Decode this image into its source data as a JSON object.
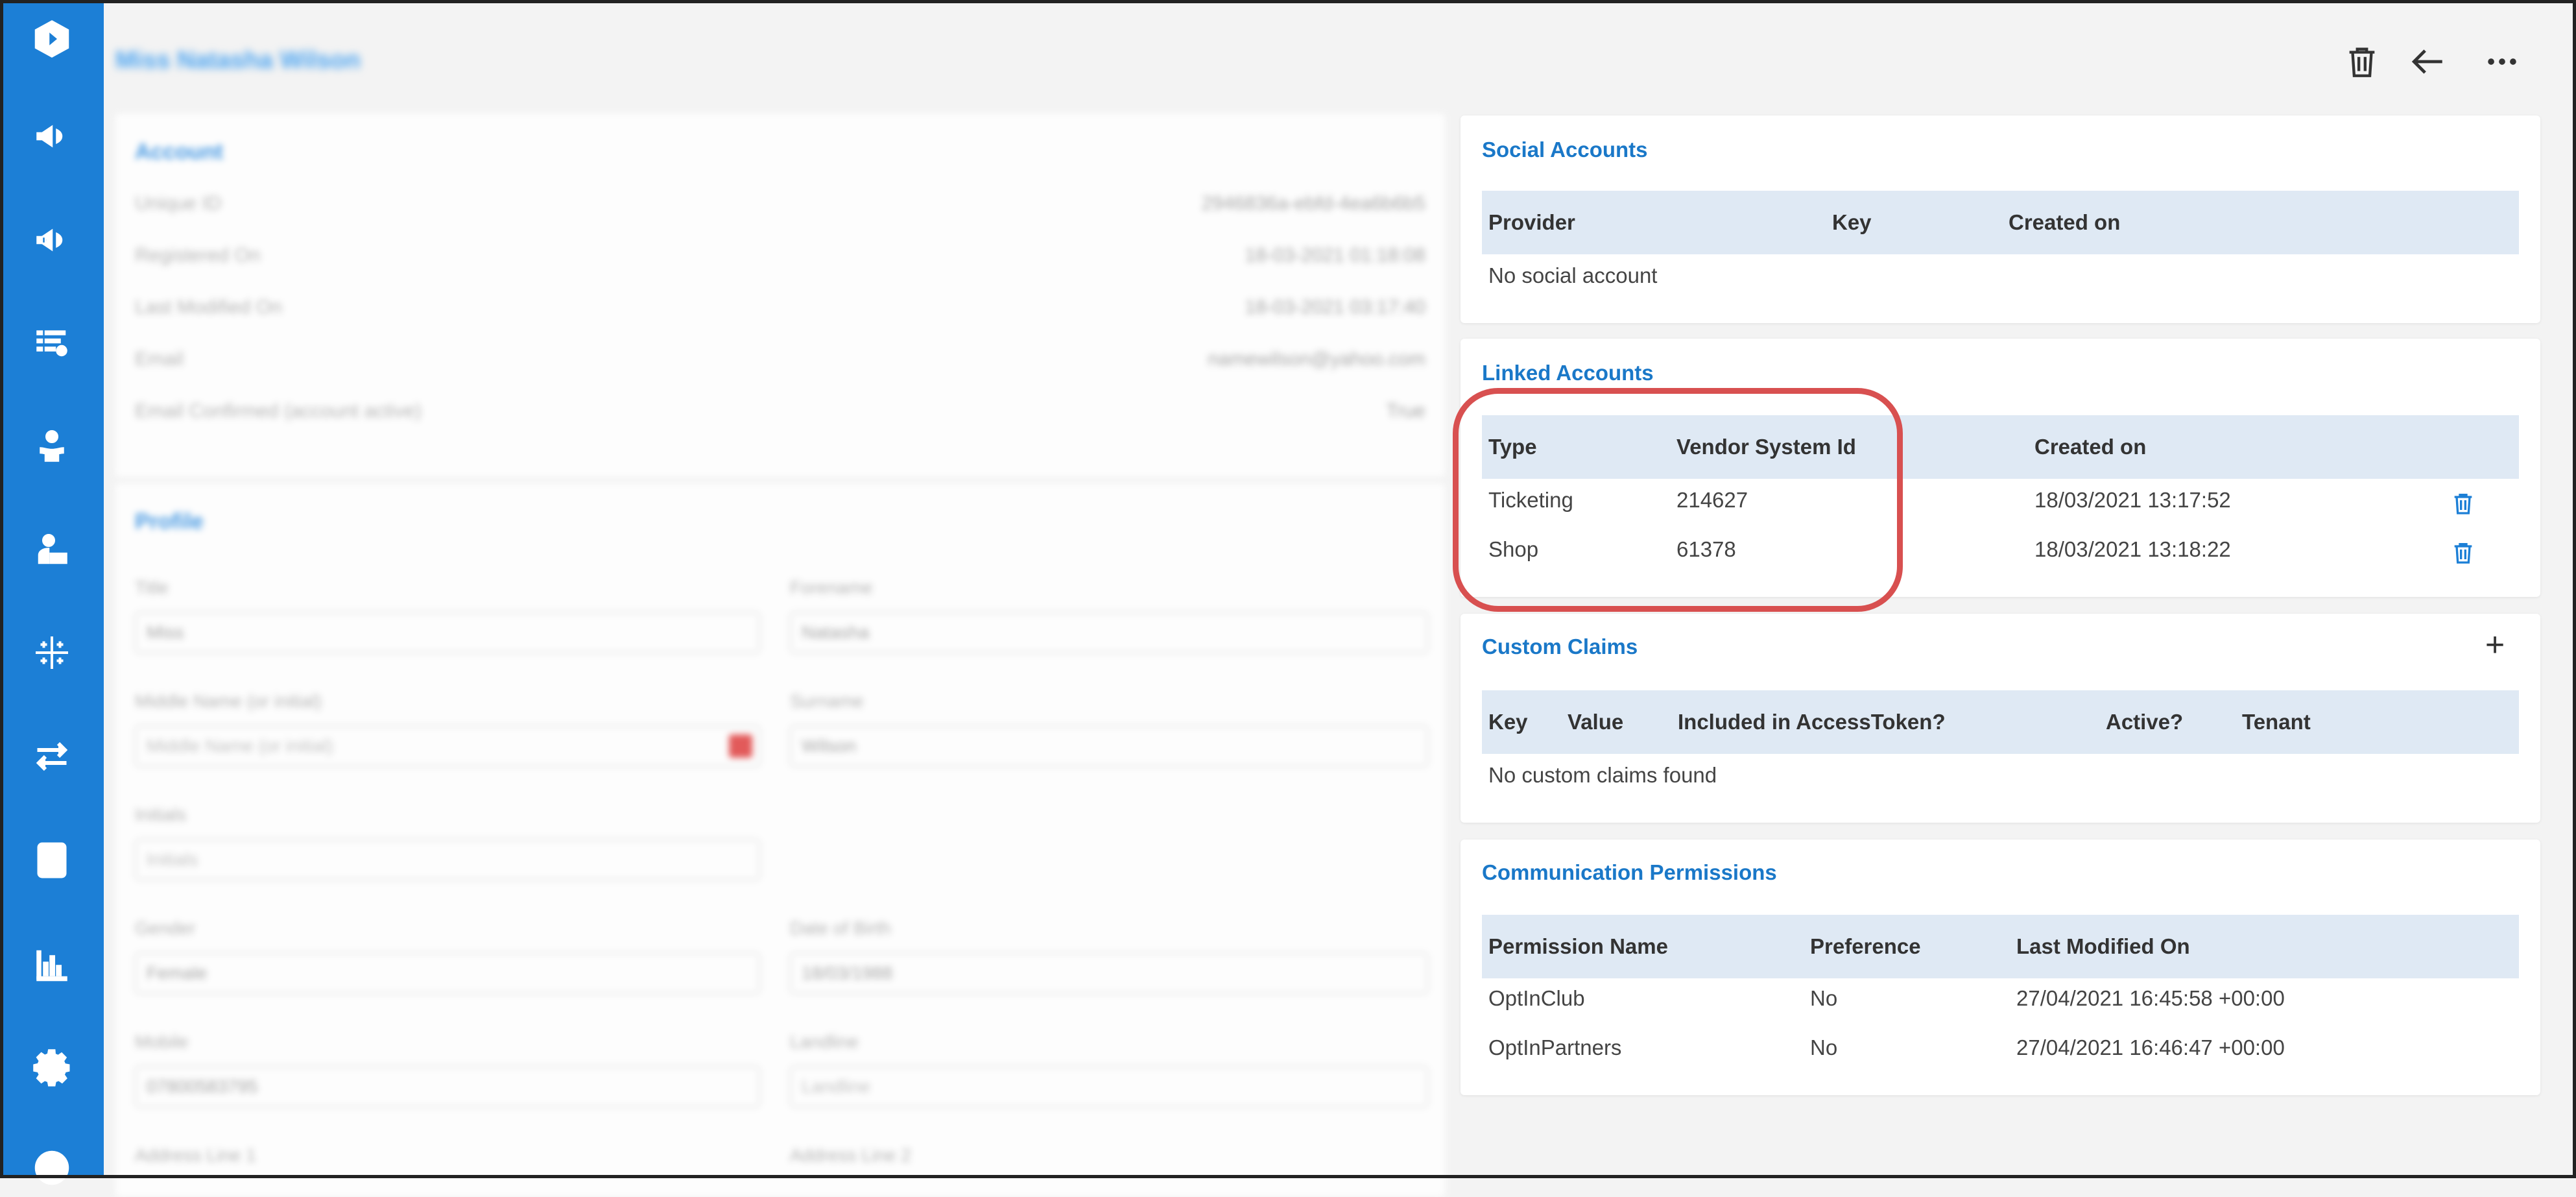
{
  "header": {
    "title": "Miss Natasha Wilson",
    "actions": [
      "trash-icon",
      "back-arrow-icon",
      "more-icon"
    ]
  },
  "sidebar": {
    "items": [
      "logo",
      "megaphone-icon",
      "megaphone-plus-icon",
      "list-settings-icon",
      "user-hand-icon",
      "user-desk-icon",
      "grid-icon",
      "transfer-icon",
      "contact-card-icon",
      "bar-chart-icon",
      "gear-icon",
      "help-icon"
    ]
  },
  "account": {
    "title": "Account",
    "rows": [
      {
        "label": "Unique ID",
        "value": "2946836a-ebfd-4ea6b6b5"
      },
      {
        "label": "Registered On",
        "value": "18-03-2021 01:18:08"
      },
      {
        "label": "Last Modified On",
        "value": "18-03-2021 03:17:40"
      },
      {
        "label": "Email",
        "value": "namewilson@yahoo.com"
      },
      {
        "label": "Email Confirmed (account active)",
        "value": "True"
      }
    ]
  },
  "profile": {
    "title": "Profile",
    "fields": [
      {
        "label": "Title",
        "value": "Miss"
      },
      {
        "label": "Forename",
        "value": "Natasha"
      },
      {
        "label": "Middle Name (or initial)",
        "value": "Middle Name (or initial)"
      },
      {
        "label": "Surname",
        "value": "Wilson"
      },
      {
        "label": "Initials",
        "value": "Initials"
      },
      {
        "label": "Gender",
        "value": "Female"
      },
      {
        "label": "Date of Birth",
        "value": "18/03/1988"
      },
      {
        "label": "Mobile",
        "value": "07800583795"
      },
      {
        "label": "Landline",
        "value": "Landline"
      },
      {
        "label": "Address Line 1",
        "value": ""
      },
      {
        "label": "Address Line 2",
        "value": ""
      }
    ]
  },
  "social_accounts": {
    "title": "Social Accounts",
    "columns": [
      "Provider",
      "Key",
      "Created on"
    ],
    "empty": "No social account"
  },
  "linked_accounts": {
    "title": "Linked Accounts",
    "columns": [
      "Type",
      "Vendor System Id",
      "Created on"
    ],
    "rows": [
      {
        "type": "Ticketing",
        "vendor_id": "214627",
        "created": "18/03/2021 13:17:52"
      },
      {
        "type": "Shop",
        "vendor_id": "61378",
        "created": "18/03/2021 13:18:22"
      }
    ]
  },
  "custom_claims": {
    "title": "Custom Claims",
    "add_label": "+",
    "columns": [
      "Key",
      "Value",
      "Included in AccessToken?",
      "Active?",
      "Tenant"
    ],
    "empty": "No custom claims found"
  },
  "communication_permissions": {
    "title": "Communication Permissions",
    "columns": [
      "Permission Name",
      "Preference",
      "Last Modified On"
    ],
    "rows": [
      {
        "name": "OptInClub",
        "preference": "No",
        "modified": "27/04/2021 16:45:58 +00:00"
      },
      {
        "name": "OptInPartners",
        "preference": "No",
        "modified": "27/04/2021 16:46:47 +00:00"
      }
    ]
  },
  "colors": {
    "sidebar": "#1c7fd6",
    "accent": "#1a78c8",
    "table_header": "#dfe9f4",
    "highlight": "#d85050"
  }
}
